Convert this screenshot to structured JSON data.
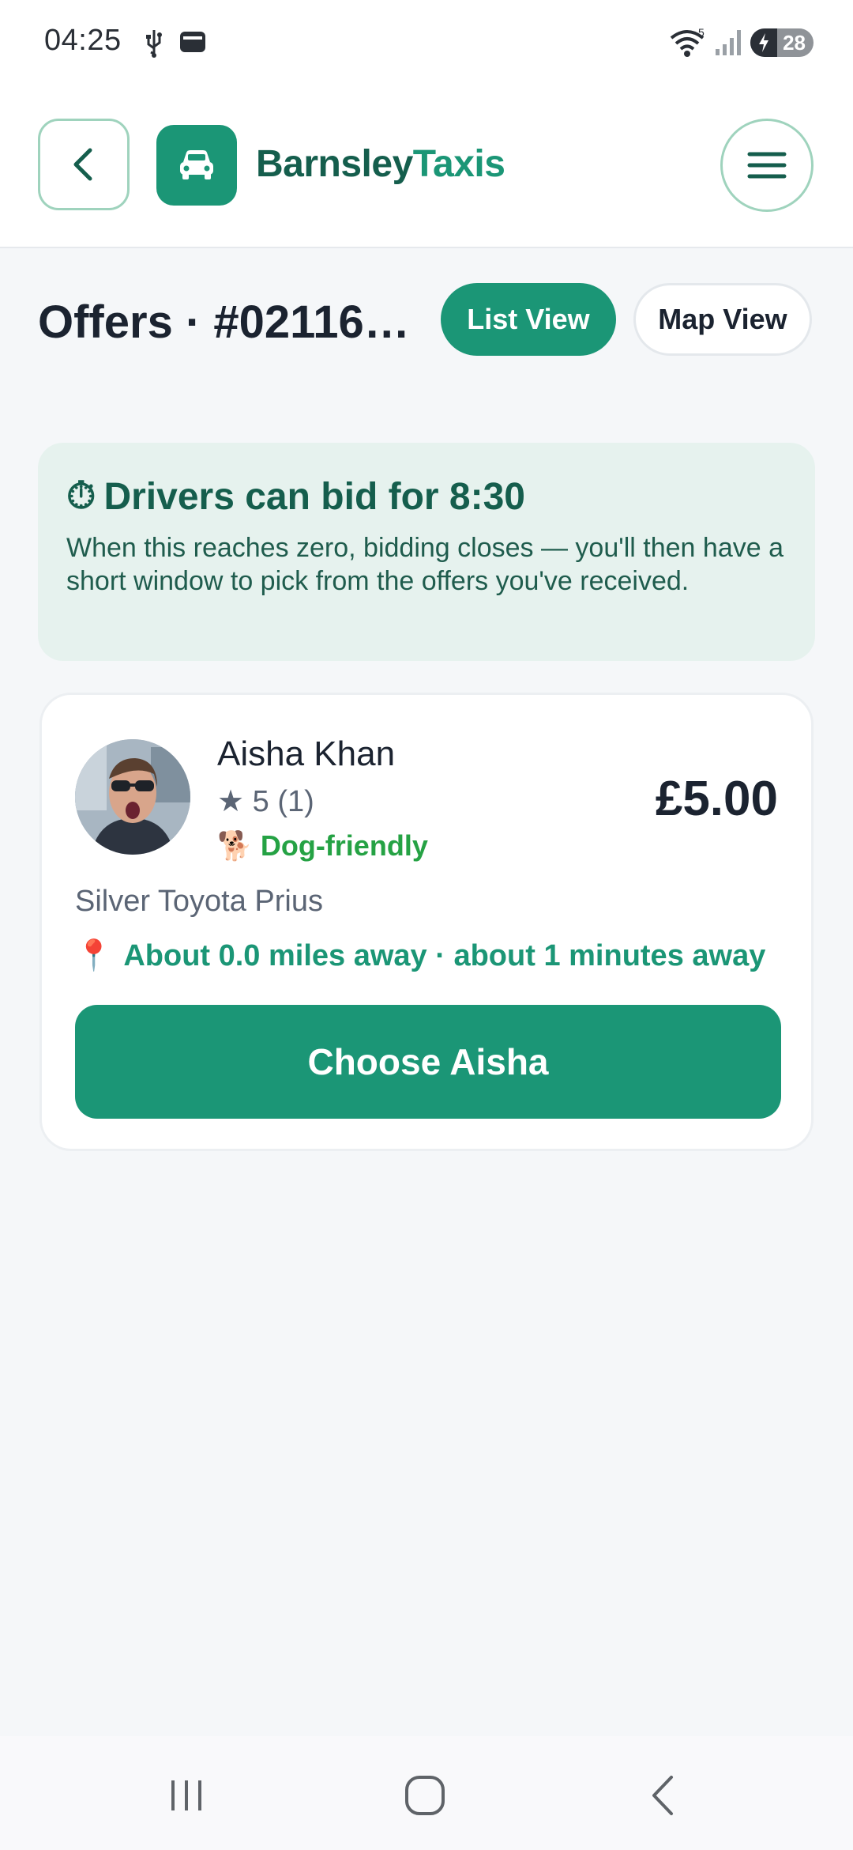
{
  "status_bar": {
    "time": "04:25",
    "battery_level": "28"
  },
  "header": {
    "brand_part1": "Barnsley",
    "brand_part2": "Taxis"
  },
  "page": {
    "title": "Offers · #02116…",
    "list_view_label": "List View",
    "map_view_label": "Map View"
  },
  "notice": {
    "icon": "⏱",
    "title": "Drivers can bid for 8:30",
    "body": "When this reaches zero, bidding closes — you'll then have a short window to pick from the offers you've received."
  },
  "offer": {
    "driver_name": "Aisha Khan",
    "rating_text": "★ 5 (1)",
    "dog_icon": "🐕",
    "dog_label": "Dog-friendly",
    "price": "£5.00",
    "vehicle": "Silver Toyota Prius",
    "pin_icon": "📍",
    "distance_text": "About 0.0 miles away · about 1 minutes away",
    "choose_label": "Choose Aisha"
  },
  "colors": {
    "accent": "#1b9676",
    "accent_dark": "#155e4d",
    "notice_bg": "#e6f2ee",
    "dog_green": "#25a244"
  }
}
